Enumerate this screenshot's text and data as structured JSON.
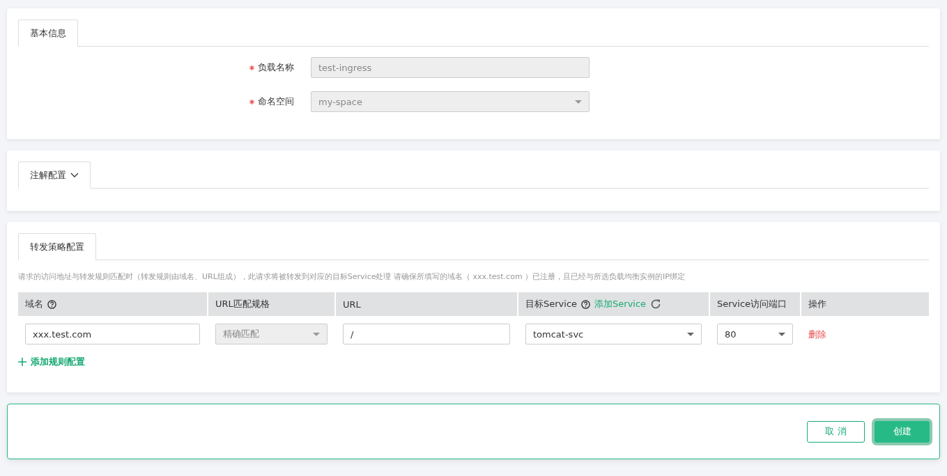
{
  "basic_info": {
    "tab": "基本信息",
    "fields": [
      {
        "kind": "text",
        "label": "负载名称",
        "required": true,
        "value": "test-ingress",
        "disabled": true
      },
      {
        "kind": "select",
        "label": "命名空间",
        "required": true,
        "value": "my-space",
        "disabled": true
      }
    ]
  },
  "annotations": {
    "tab": "注解配置",
    "expanded": false
  },
  "forwarding": {
    "tab": "转发策略配置",
    "description": "请求的访问地址与转发规则匹配时（转发规则由域名、URL组成），此请求将被转发到对应的目标Service处理 请确保所填写的域名（ xxx.test.com ）已注册，且已经与所选负载均衡实例的IP绑定",
    "columns": [
      {
        "label": "域名",
        "help": true
      },
      {
        "label": "URL匹配规格",
        "help": false
      },
      {
        "label": "URL",
        "help": false
      },
      {
        "label": "目标Service",
        "help": true,
        "link": "添加Service",
        "refresh": true
      },
      {
        "label": "Service访问端口",
        "help": false
      },
      {
        "label": "操作",
        "help": false
      }
    ],
    "rows": [
      {
        "domain": "xxx.test.com",
        "match": {
          "value": "精确匹配",
          "disabled": true
        },
        "url": "/",
        "service": {
          "value": "tomcat-svc",
          "disabled": false
        },
        "port": {
          "value": "80",
          "disabled": false
        },
        "action": "删除"
      }
    ],
    "add_rule": "添加规则配置"
  },
  "footer": {
    "buttons": [
      {
        "label": "取 消",
        "kind": "secondary"
      },
      {
        "label": "创建",
        "kind": "primary"
      }
    ]
  }
}
